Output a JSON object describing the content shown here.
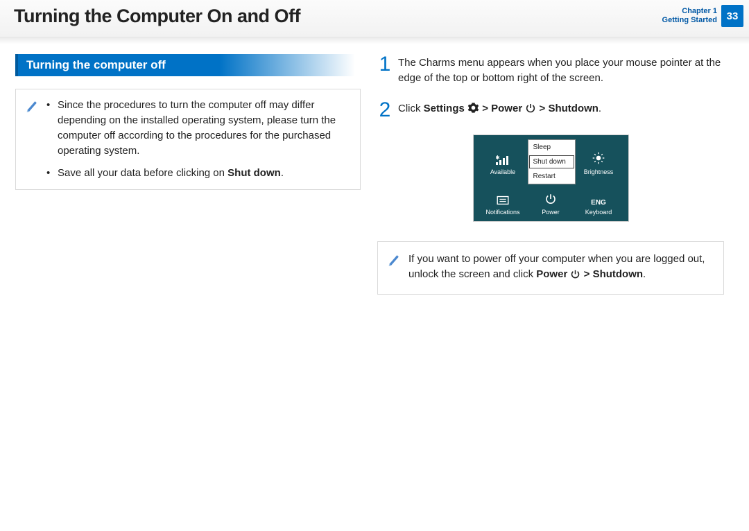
{
  "header": {
    "title": "Turning the Computer On and Off",
    "chapter_line1": "Chapter 1",
    "chapter_line2": "Getting Started",
    "page": "33"
  },
  "section_heading": "Turning the computer off",
  "left_note": {
    "b1a": "Since the procedures to turn the computer off may differ depending on the installed operating system, please turn the computer off according to the procedures for the purchased operating system.",
    "b2a": "Save all your data before clicking on ",
    "b2b": "Shut down",
    "b2c": "."
  },
  "steps": {
    "s1_num": "1",
    "s1_text": "The Charms menu appears when you place your mouse pointer at the edge of the top or bottom right of the screen.",
    "s2_num": "2",
    "s2_a": "Click ",
    "s2_b": "Settings",
    "s2_c": " > ",
    "s2_d": "Power",
    "s2_e": " > ",
    "s2_f": "Shutdown",
    "s2_g": "."
  },
  "charms": {
    "available": "Available",
    "brightness": "Brightness",
    "notifications": "Notifications",
    "power": "Power",
    "keyboard": "Keyboard",
    "keyboard_lang": "ENG",
    "menu_sleep": "Sleep",
    "menu_shutdown": "Shut down",
    "menu_restart": "Restart"
  },
  "right_note": {
    "a": "If you want to power off your computer when you are logged out, unlock the screen and click ",
    "b": "Power",
    "c": " > ",
    "d": "Shutdown",
    "e": "."
  }
}
